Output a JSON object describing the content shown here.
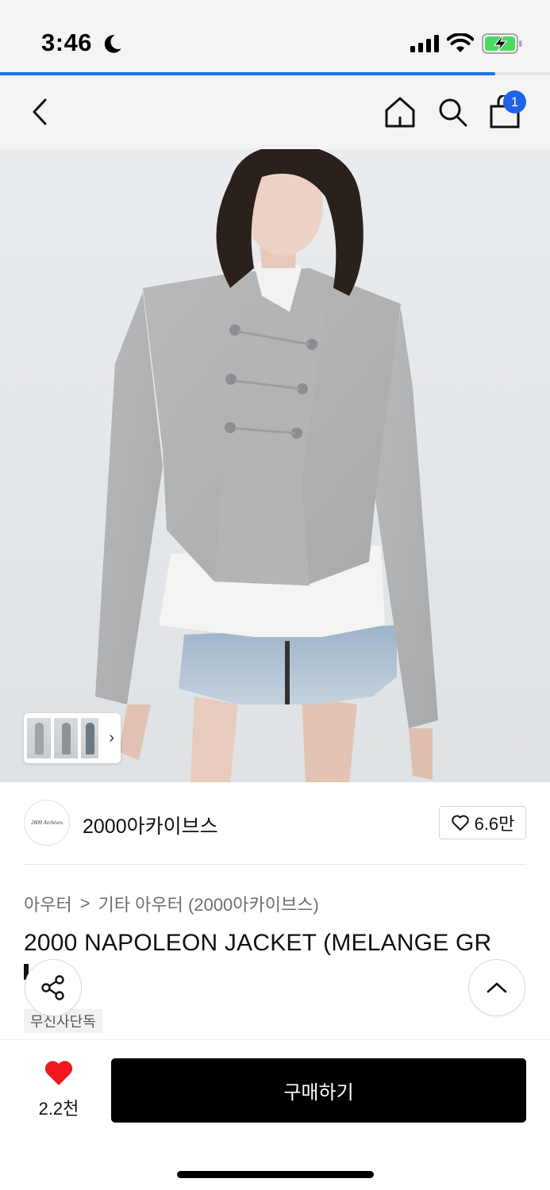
{
  "status_bar": {
    "time": "3:46",
    "icons": [
      "moon-icon",
      "cellular-signal-icon",
      "wifi-icon",
      "battery-charging-icon"
    ],
    "battery_color": "#4cd964"
  },
  "page_load_progress": 0.9,
  "nav": {
    "icons": [
      "chevron-left-icon",
      "home-icon",
      "search-icon",
      "shopping-bag-icon"
    ],
    "cart_badge": "1",
    "badge_color": "#1f63e9"
  },
  "gallery": {
    "thumbnail_arrow": "›",
    "icons": [
      "expand-icon"
    ]
  },
  "brand": {
    "logo_text": "2000 Archives",
    "name": "2000아카이브스",
    "like_count": "6.6만"
  },
  "breadcrumb": {
    "level1": "아우터",
    "separator": ">",
    "level2": "기타 아우터 (2000아카이브스)"
  },
  "product": {
    "title": "2000 NAPOLEON JACKET (MELANGE GR",
    "badge": "무신사단독"
  },
  "actions": {
    "wish_count": "2.2천",
    "buy_label": "구매하기",
    "heart_color": "#f0171e"
  }
}
